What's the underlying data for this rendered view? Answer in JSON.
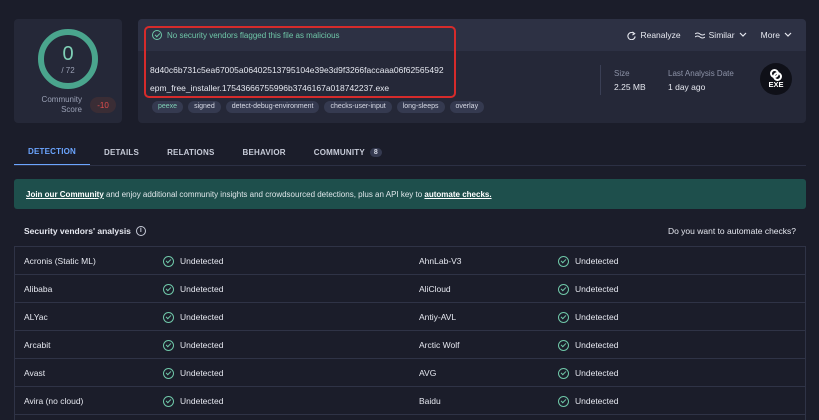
{
  "score": {
    "detections": "0",
    "total": "/ 72",
    "community_label": "Community\nScore",
    "community_value": "-10"
  },
  "header": {
    "status": "No security vendors flagged this file as malicious",
    "hash": "8d40c6b731c5ea67005a06402513795104e39e3d9f3266faccaaa06f62565492",
    "filename": "epm_free_installer.17543666755996b3746167a018742237.exe",
    "tags": [
      "peexe",
      "signed",
      "detect-debug-environment",
      "checks-user-input",
      "long-sleeps",
      "overlay"
    ],
    "actions": {
      "reanalyze": "Reanalyze",
      "similar": "Similar",
      "more": "More"
    },
    "size_label": "Size",
    "size_value": "2.25 MB",
    "date_label": "Last Analysis Date",
    "date_value": "1 day ago",
    "filetype": "EXE"
  },
  "tabs": [
    {
      "label": "DETECTION"
    },
    {
      "label": "DETAILS"
    },
    {
      "label": "RELATIONS"
    },
    {
      "label": "BEHAVIOR"
    },
    {
      "label": "COMMUNITY",
      "count": "8"
    }
  ],
  "banner": {
    "link1": "Join our Community",
    "text": " and enjoy additional community insights and crowdsourced detections, plus an API key to ",
    "link2": "automate checks."
  },
  "vendors": {
    "title": "Security vendors' analysis",
    "ask": "Do you want to automate checks?",
    "rows": [
      {
        "left": "Acronis (Static ML)",
        "left_result": "Undetected",
        "right": "AhnLab-V3",
        "right_result": "Undetected"
      },
      {
        "left": "Alibaba",
        "left_result": "Undetected",
        "right": "AliCloud",
        "right_result": "Undetected"
      },
      {
        "left": "ALYac",
        "left_result": "Undetected",
        "right": "Antiy-AVL",
        "right_result": "Undetected"
      },
      {
        "left": "Arcabit",
        "left_result": "Undetected",
        "right": "Arctic Wolf",
        "right_result": "Undetected"
      },
      {
        "left": "Avast",
        "left_result": "Undetected",
        "right": "AVG",
        "right_result": "Undetected"
      },
      {
        "left": "Avira (no cloud)",
        "left_result": "Undetected",
        "right": "Baidu",
        "right_result": "Undetected"
      }
    ]
  }
}
